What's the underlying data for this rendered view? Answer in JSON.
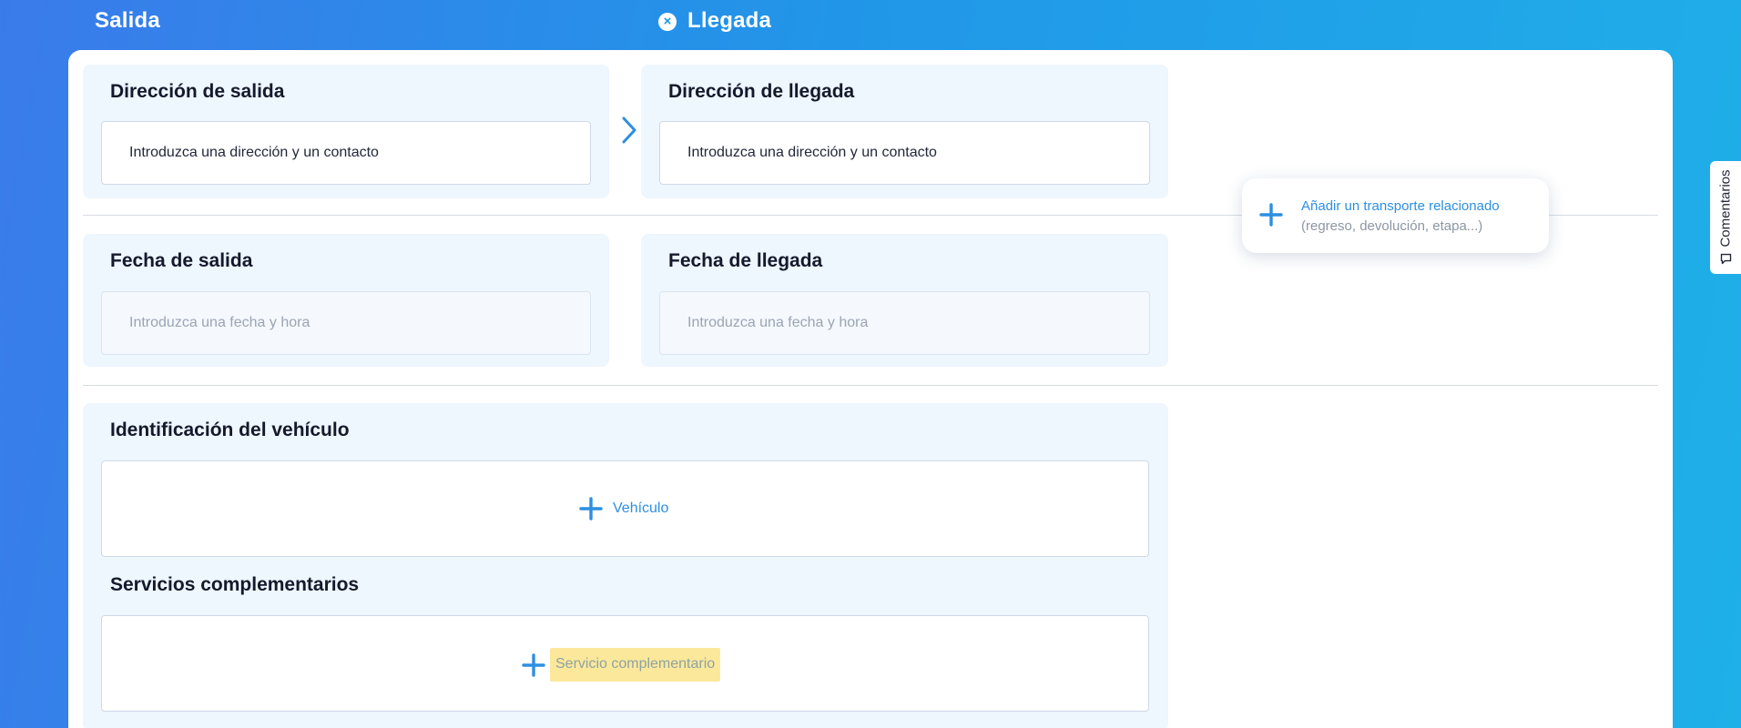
{
  "header": {
    "departure_label": "Salida",
    "arrival_label": "Llegada",
    "close_glyph": "×"
  },
  "departure_address": {
    "title": "Dirección de salida",
    "placeholder": "Introduzca una dirección y un contacto"
  },
  "arrival_address": {
    "title": "Dirección de llegada",
    "placeholder": "Introduzca una dirección y un contacto"
  },
  "departure_date": {
    "title": "Fecha de salida",
    "placeholder": "Introduzca una fecha y hora"
  },
  "arrival_date": {
    "title": "Fecha de llegada",
    "placeholder": "Introduzca una fecha y hora"
  },
  "vehicle": {
    "title": "Identificación del vehículo",
    "add_label": "Vehículo"
  },
  "services": {
    "title": "Servicios complementarios",
    "add_label": "Servicio complementario"
  },
  "related_transport": {
    "title": "Añadir un transporte relacionado",
    "subtitle": "(regreso, devolución, etapa...)"
  },
  "comments_tab": {
    "label": "Comentarios"
  },
  "icons": {
    "close": "close-circle-icon",
    "chevron": "chevron-right-icon",
    "plus": "plus-icon",
    "comment": "comment-bubble-icon"
  },
  "colors": {
    "accent": "#2d8fe0",
    "highlight": "#fbe89b",
    "section_bg": "#eef6fe"
  }
}
